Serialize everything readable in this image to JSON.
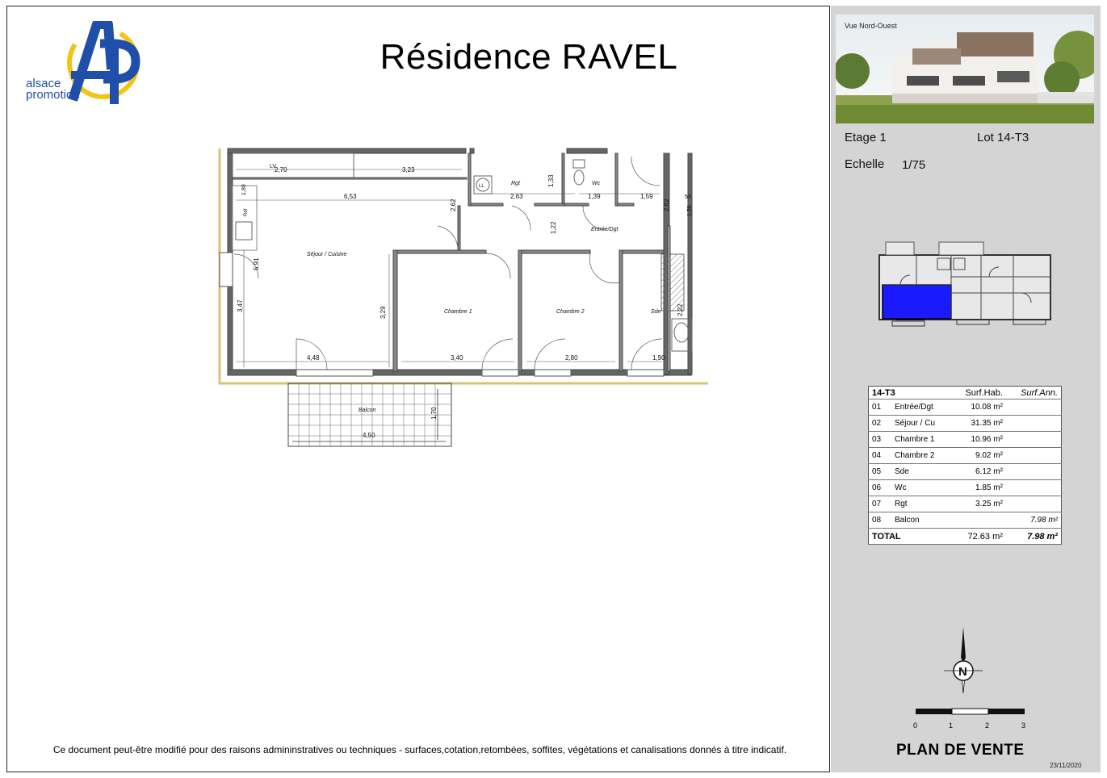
{
  "header": {
    "title": "Résidence RAVEL"
  },
  "logo": {
    "line1": "alsace",
    "line2": "promotion"
  },
  "plan": {
    "rooms": {
      "sejour": "Séjour / Cuisine",
      "chambre1": "Chambre 1",
      "chambre2": "Chambre 2",
      "sde": "Sde",
      "rgt": "Rgt",
      "wc": "Wc",
      "entree": "Entrée/Dgt",
      "balcon": "Balcon"
    },
    "fixtures": {
      "lv": "LV",
      "ll": "LL",
      "ref": "Réf"
    },
    "dims": {
      "d270": "2,70",
      "d323": "3,23",
      "d653": "6,53",
      "d263": "2,63",
      "d133": "1,33",
      "d139": "1,39",
      "d159": "1,59",
      "d262a": "2,62",
      "d262b": "2,62",
      "d122": "1,22",
      "d591": "5,91",
      "d347": "3,47",
      "d329": "3,29",
      "d448": "4,48",
      "d340": "3,40",
      "d280": "2,80",
      "d190": "1,90",
      "d222": "2,22",
      "d170": "1,70",
      "d450": "4,50",
      "d180": "1,80",
      "d53": "53",
      "d158": "1,58"
    }
  },
  "disclaimer": "Ce document peut-être modifié pour des raisons admininstratives ou techniques - surfaces,cotation,retombées, soffites, végétations et canalisations donnés à titre indicatif.",
  "side": {
    "photo_caption": "Vue Nord-Ouest",
    "etage": "Etage 1",
    "lot": "Lot 14-T3",
    "echelle_label": "Echelle",
    "echelle_value": "1/75",
    "table": {
      "lot": "14-T3",
      "col_hab": "Surf.Hab.",
      "col_ann": "Surf.Ann.",
      "rows": [
        {
          "num": "01",
          "name": "Entrée/Dgt",
          "hab": "10.08 m²",
          "ann": ""
        },
        {
          "num": "02",
          "name": "Séjour / Cu",
          "hab": "31.35 m²",
          "ann": ""
        },
        {
          "num": "03",
          "name": "Chambre 1",
          "hab": "10.96 m²",
          "ann": ""
        },
        {
          "num": "04",
          "name": "Chambre 2",
          "hab": "9.02 m²",
          "ann": ""
        },
        {
          "num": "05",
          "name": "Sde",
          "hab": "6.12 m²",
          "ann": ""
        },
        {
          "num": "06",
          "name": "Wc",
          "hab": "1.85 m²",
          "ann": ""
        },
        {
          "num": "07",
          "name": "Rgt",
          "hab": "3.25 m²",
          "ann": ""
        },
        {
          "num": "08",
          "name": "Balcon",
          "hab": "",
          "ann": "7.98 m²"
        }
      ],
      "total_label": "TOTAL",
      "total_hab": "72.63 m²",
      "total_ann": "7.98 m²"
    },
    "north_label": "N",
    "scale_ticks": [
      "0",
      "1",
      "2",
      "3"
    ],
    "plan_de_vente": "PLAN DE VENTE",
    "date": "23/11/2020",
    "colors": {
      "highlight": "#1a1aff",
      "panel": "#d4d4d4",
      "logo_blue": "#1f4fa8",
      "logo_yellow": "#f3c316"
    }
  }
}
